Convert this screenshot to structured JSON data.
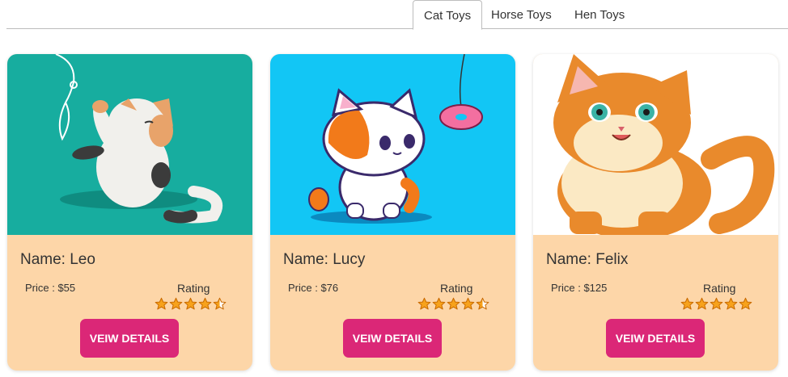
{
  "tabs": [
    {
      "label": "Cat Toys",
      "active": true
    },
    {
      "label": "Horse Toys",
      "active": false
    },
    {
      "label": "Hen Toys",
      "active": false
    }
  ],
  "cards": [
    {
      "name": "Name: Leo",
      "price": "Price : $55",
      "rating_label": "Rating",
      "rating": 4.5,
      "button": "VEIW DETAILS",
      "image_bg": "#17ad9f"
    },
    {
      "name": "Name: Lucy",
      "price": "Price : $76",
      "rating_label": "Rating",
      "rating": 4.5,
      "button": "VEIW DETAILS",
      "image_bg": "#12c6f5"
    },
    {
      "name": "Name: Felix",
      "price": "Price : $125",
      "rating_label": "Rating",
      "rating": 5,
      "button": "VEIW DETAILS",
      "image_bg": "#ffffff"
    }
  ],
  "colors": {
    "card_bg": "#fdd6a8",
    "button": "#db2777",
    "star_fill": "#f7a21b",
    "star_stroke": "#c96a00"
  }
}
